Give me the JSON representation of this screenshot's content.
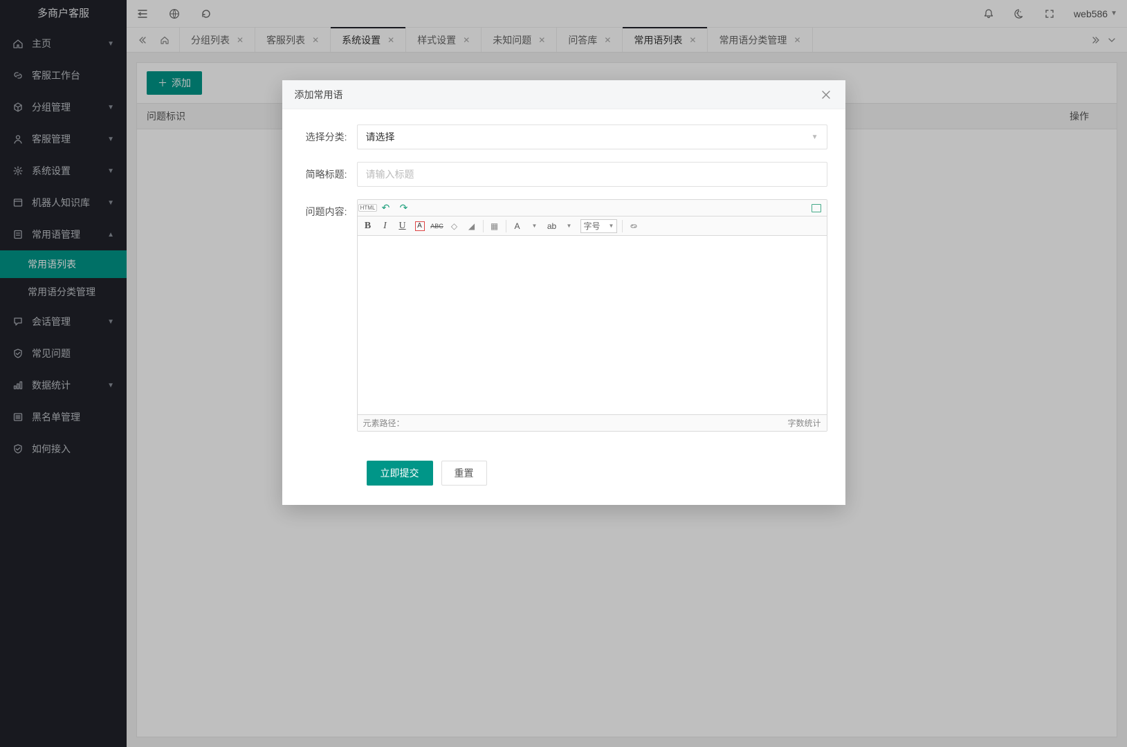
{
  "brand": "多商户客服",
  "user": "web586",
  "sidebar": [
    {
      "label": "主页",
      "icon": "home",
      "caret": true
    },
    {
      "label": "客服工作台",
      "icon": "link",
      "caret": false
    },
    {
      "label": "分组管理",
      "icon": "cube",
      "caret": true
    },
    {
      "label": "客服管理",
      "icon": "user",
      "caret": true
    },
    {
      "label": "系统设置",
      "icon": "gear",
      "caret": true
    },
    {
      "label": "机器人知识库",
      "icon": "box",
      "caret": true
    },
    {
      "label": "常用语管理",
      "icon": "note",
      "caret": true,
      "open": true,
      "children": [
        {
          "label": "常用语列表",
          "active": true
        },
        {
          "label": "常用语分类管理",
          "active": false
        }
      ]
    },
    {
      "label": "会话管理",
      "icon": "chat",
      "caret": true
    },
    {
      "label": "常见问题",
      "icon": "shield",
      "caret": false
    },
    {
      "label": "数据统计",
      "icon": "stats",
      "caret": true
    },
    {
      "label": "黑名单管理",
      "icon": "list",
      "caret": false
    },
    {
      "label": "如何接入",
      "icon": "shield",
      "caret": false
    }
  ],
  "tabs": [
    {
      "label": "分组列表",
      "active": false
    },
    {
      "label": "客服列表",
      "active": false
    },
    {
      "label": "系统设置",
      "active": false,
      "bar": true
    },
    {
      "label": "样式设置",
      "active": false
    },
    {
      "label": "未知问题",
      "active": false
    },
    {
      "label": "问答库",
      "active": false
    },
    {
      "label": "常用语列表",
      "active": true
    },
    {
      "label": "常用语分类管理",
      "active": false
    }
  ],
  "page": {
    "add_button": "添加",
    "table_headers": {
      "left": "问题标识",
      "right": "操作"
    }
  },
  "modal": {
    "title": "添加常用语",
    "fields": {
      "category_label": "选择分类:",
      "category_placeholder": "请选择",
      "title_label": "简略标题:",
      "title_placeholder": "请输入标题",
      "content_label": "问题内容:"
    },
    "editor": {
      "font_size_label": "字号",
      "path_label": "元素路径：",
      "word_count_label": "字数统计"
    },
    "buttons": {
      "submit": "立即提交",
      "reset": "重置"
    }
  }
}
